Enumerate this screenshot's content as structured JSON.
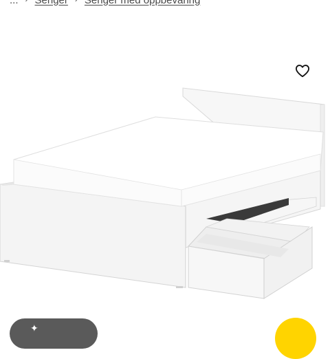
{
  "breadcrumb": {
    "ellipsis": "...",
    "separator": "›",
    "items": [
      "Senger",
      "Senger med oppbevaring"
    ]
  },
  "favorite": {
    "icon": "heart-outline-icon"
  },
  "colors": {
    "background": "#ffffff",
    "pill": "#5a5a5a",
    "fab": "#ffd400",
    "text": "#484848"
  }
}
